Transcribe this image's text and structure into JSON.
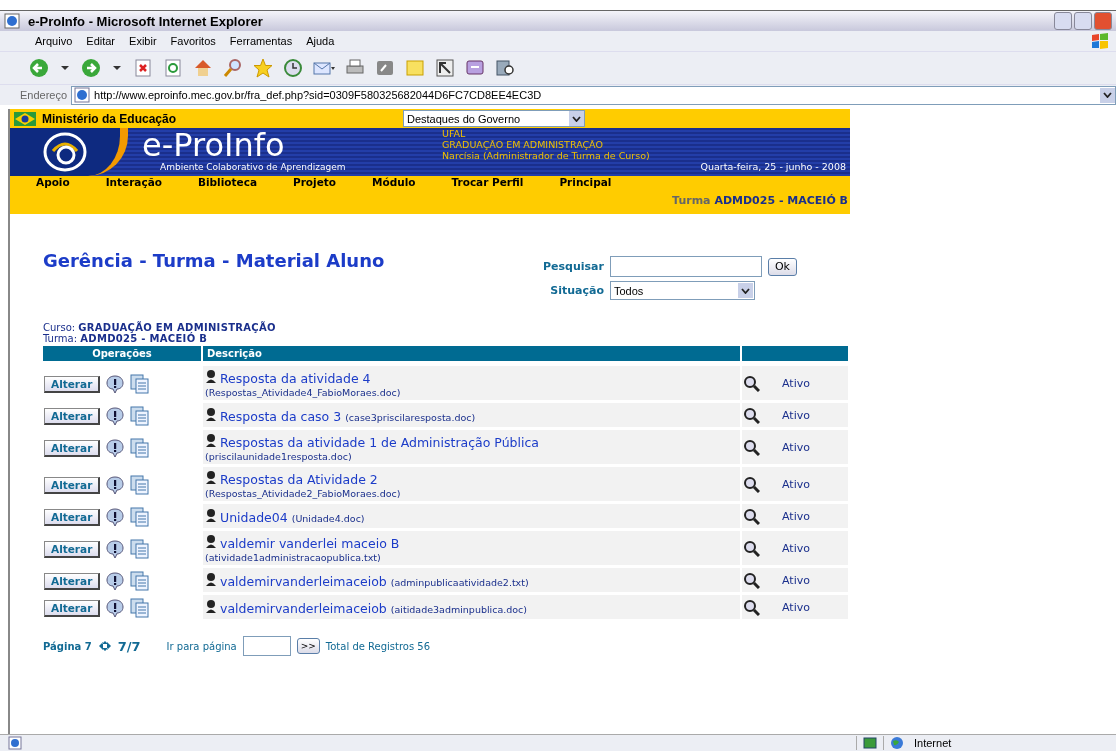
{
  "window": {
    "title": "e-ProInfo - Microsoft Internet Explorer"
  },
  "menu": [
    "Arquivo",
    "Editar",
    "Exibir",
    "Favoritos",
    "Ferramentas",
    "Ajuda"
  ],
  "address_bar": {
    "label": "Endereço",
    "url": "http://www.eproinfo.mec.gov.br/fra_def.php?sid=0309F580325682044D6FC7CD8EE4EC3D"
  },
  "banner": {
    "ministry": "Ministério da Educação",
    "dropdown": "Destaques do Governo",
    "logo": "e-ProInfo",
    "tagline": "Ambiente Colaborativo de Aprendizagem",
    "info": [
      "UFAL",
      "GRADUAÇÃO EM ADMINISTRAÇÃO",
      "Narcísia (Administrador de Turma de Curso)"
    ],
    "date": "Quarta-feira, 25 - junho - 2008",
    "nav": [
      "Apoio",
      "Interação",
      "Biblioteca",
      "Projeto",
      "Módulo",
      "Trocar Perfil",
      "Principal"
    ],
    "turma_label": "Turma",
    "turma_value": "ADMD025 - MACEIÓ B"
  },
  "page": {
    "title": "Gerência - Turma - Material Aluno",
    "search": {
      "label": "Pesquisar",
      "button": "Ok"
    },
    "status_filter": {
      "label": "Situação",
      "value": "Todos"
    },
    "course": {
      "label": "Curso:",
      "value": "GRADUAÇÃO EM ADMINISTRAÇÃO"
    },
    "class": {
      "label": "Turma:",
      "value": "ADMD025 - MACEIÓ B"
    }
  },
  "table": {
    "columns": [
      "Operações",
      "Descrição"
    ],
    "rows": [
      {
        "kind": "wrapped",
        "action": "Alterar",
        "title": "Resposta da atividade 4",
        "file": "(Respostas_Atividade4_FabioMoraes.doc)",
        "status": "Ativo"
      },
      {
        "kind": "inline",
        "action": "Alterar",
        "title": "Resposta da caso 3",
        "file": "(case3priscilaresposta.doc)",
        "status": "Ativo"
      },
      {
        "kind": "wrapped",
        "action": "Alterar",
        "title": "Respostas da atividade 1 de Administração Pública",
        "file": "(priscilaunidade1resposta.doc)",
        "status": "Ativo"
      },
      {
        "kind": "wrapped",
        "action": "Alterar",
        "title": "Respostas da Atividade 2",
        "file": "(Respostas_Atividade2_FabioMoraes.doc)",
        "status": "Ativo"
      },
      {
        "kind": "inline",
        "action": "Alterar",
        "title": "Unidade04",
        "file": "(Unidade4.doc)",
        "status": "Ativo"
      },
      {
        "kind": "wrapped",
        "action": "Alterar",
        "title": "valdemir vanderlei maceio B",
        "file": "(atividade1administracaopublica.txt)",
        "status": "Ativo"
      },
      {
        "kind": "inline",
        "action": "Alterar",
        "title": "valdemirvanderleimaceiob",
        "file": "(adminpublicaatividade2.txt)",
        "status": "Ativo"
      },
      {
        "kind": "inline",
        "action": "Alterar",
        "title": "valdemirvanderleimaceiob",
        "file": "(aitidade3adminpublica.doc)",
        "status": "Ativo"
      }
    ]
  },
  "pagination": {
    "page": "Página 7",
    "pages": "7/7",
    "goto_label": "Ir para página",
    "goto_button": ">>",
    "total": "Total de Registros 56"
  },
  "status_bar": {
    "zone": "Internet"
  }
}
